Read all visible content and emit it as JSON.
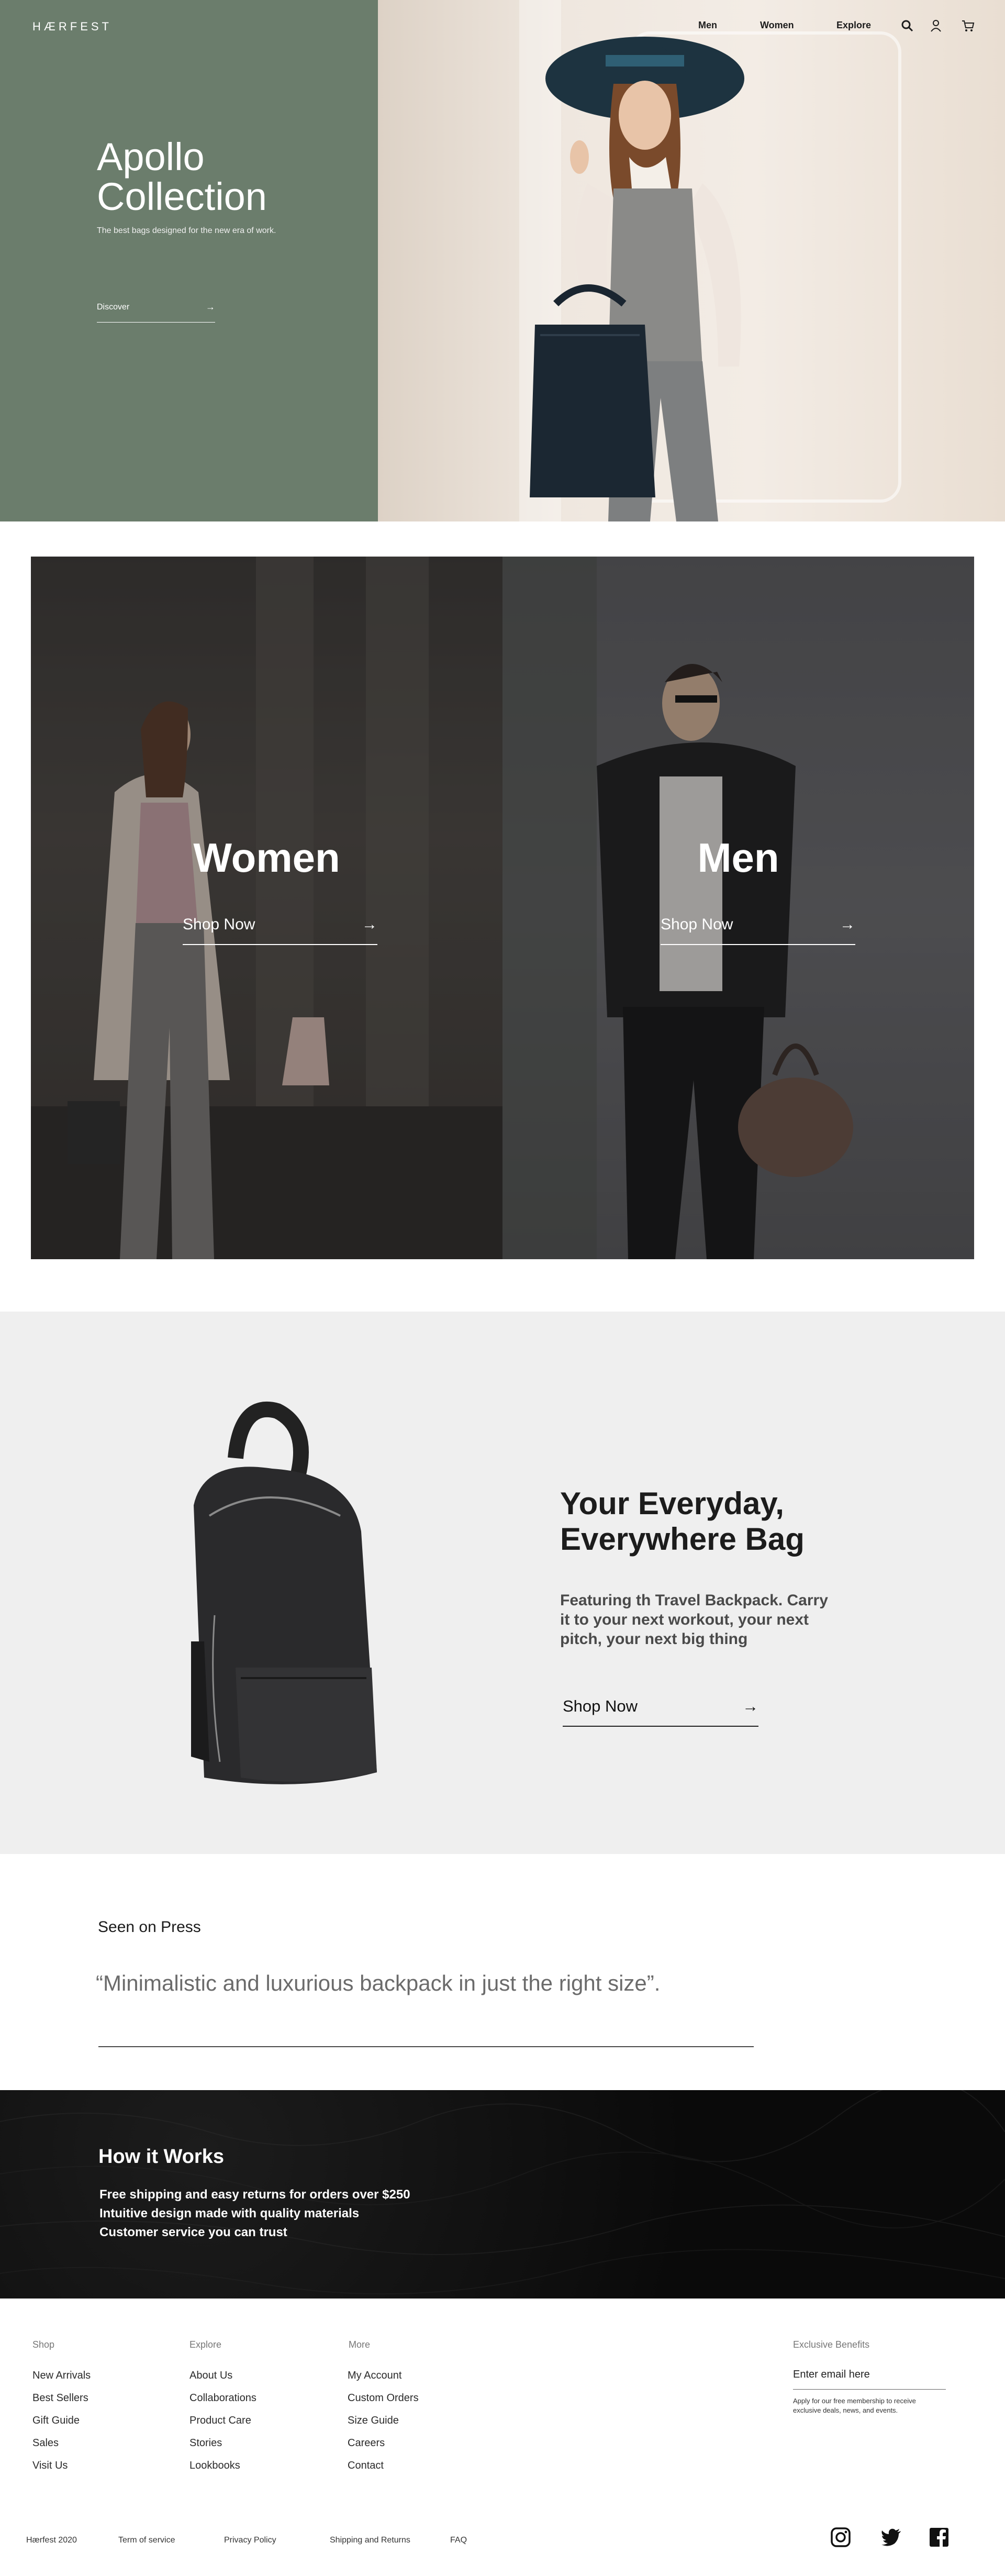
{
  "brand": {
    "logo": "HÆRFEST"
  },
  "nav": {
    "links": [
      "Men",
      "Women",
      "Explore"
    ]
  },
  "hero": {
    "title": "Apollo Collection",
    "subtitle": "The best bags designed for the new era of work.",
    "cta": "Discover"
  },
  "categories": [
    {
      "title": "Women",
      "cta": "Shop Now"
    },
    {
      "title": "Men",
      "cta": "Shop Now"
    }
  ],
  "feature": {
    "title": "Your Everyday, Everywhere Bag",
    "text": "Featuring th Travel Backpack. Carry it to your next workout, your next pitch, your next big thing",
    "cta": "Shop Now"
  },
  "press": {
    "label": "Seen on Press",
    "quote": "“Minimalistic and luxurious backpack in just the right size”."
  },
  "how": {
    "title": "How it Works",
    "items": [
      "Free shipping and easy returns for orders over $250",
      "Intuitive design made with quality materials",
      "Customer service you can trust"
    ]
  },
  "footer": {
    "columns": [
      {
        "heading": "Shop",
        "links": [
          "New Arrivals",
          "Best Sellers",
          "Gift Guide",
          "Sales",
          "Visit Us"
        ]
      },
      {
        "heading": "Explore",
        "links": [
          "About Us",
          "Collaborations",
          "Product Care",
          "Stories",
          "Lookbooks"
        ]
      },
      {
        "heading": "More",
        "links": [
          "My Account",
          "Custom Orders",
          "Size Guide",
          "Careers",
          "Contact"
        ]
      }
    ],
    "benefits": {
      "heading": "Exclusive Benefits",
      "placeholder": "Enter email here",
      "note": "Apply for our free membership to receive exclusive deals, news, and events."
    },
    "bottom": [
      "Hærfest 2020",
      "Term of service",
      "Privacy Policy",
      "Shipping and Returns",
      "FAQ"
    ]
  },
  "colors": {
    "hero_green": "#6b7d6c",
    "feature_bg": "#efefef",
    "dark": "#0b0b0b"
  }
}
